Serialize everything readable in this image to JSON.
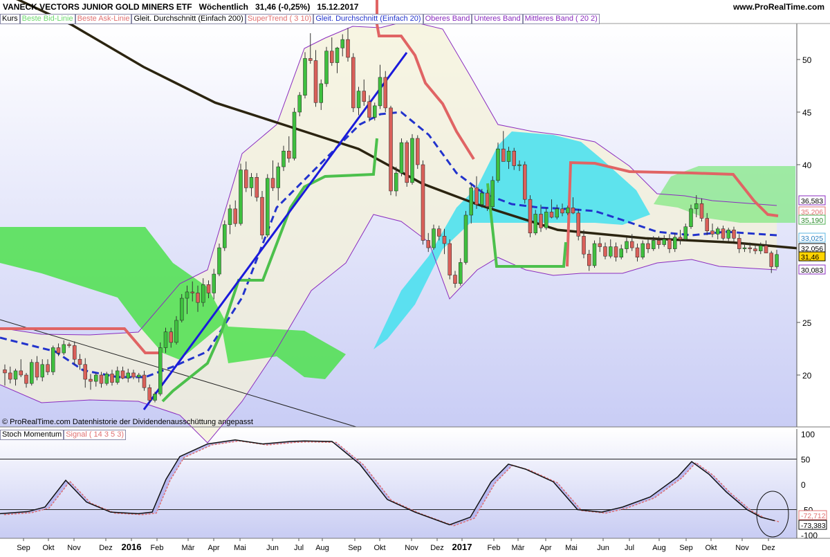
{
  "header": {
    "instrument": "VANECK VECTORS JUNIOR GOLD MINERS ETF",
    "period": "Wöchentlich",
    "last": "31,46 (-0,25%)",
    "date": "15.12.2017",
    "site": "www.ProRealTime.com"
  },
  "legend": [
    {
      "label": "Kurs",
      "color": "#000000"
    },
    {
      "label": "Beste Bid-Linie",
      "color": "#6dd86d"
    },
    {
      "label": "Beste Ask-Linie",
      "color": "#e07070"
    },
    {
      "label": "Gleit. Durchschnitt (Einfach 200)",
      "color": "#000000"
    },
    {
      "label": "SuperTrend ( 3 10)",
      "color": "#e07070"
    },
    {
      "label": "Gleit. Durchschnitt (Einfach 20)",
      "color": "#2233cc"
    },
    {
      "label": "Oberes Band",
      "color": "#8a2bbf"
    },
    {
      "label": "Unteres Band",
      "color": "#8a2bbf"
    },
    {
      "label": "Mittleres Band ( 20 2)",
      "color": "#8a2bbf"
    }
  ],
  "footnote": "© ProRealTime.com  Datenhistorie der Dividendenausschüttung angepasst",
  "lower_legend": [
    {
      "label": "Stoch Momentum",
      "color": "#000000"
    },
    {
      "label": "Signal ( 14 3 5 3)",
      "color": "#e07070"
    }
  ],
  "x_labels": [
    "Sep",
    "Okt",
    "Nov",
    "Dez",
    "2016",
    "Feb",
    "Mär",
    "Apr",
    "Mai",
    "Jun",
    "Jul",
    "Aug",
    "Sep",
    "Okt",
    "Nov",
    "Dez",
    "2017",
    "Feb",
    "Mär",
    "Apr",
    "Mai",
    "Jun",
    "Jul",
    "Aug",
    "Sep",
    "Okt",
    "Nov",
    "Dez"
  ],
  "x_bold": [
    "2016",
    "2017"
  ],
  "price_axis": {
    "ticks": [
      "50",
      "45",
      "40",
      "25",
      "20"
    ]
  },
  "price_badges": [
    {
      "text": "36,583",
      "border": "#8a2bbf",
      "bg": "#ffffff",
      "color": "#000000"
    },
    {
      "text": "35,206",
      "border": "#e07070",
      "bg": "#ffffff",
      "color": "#e07070"
    },
    {
      "text": "35,190",
      "border": "#4caf50",
      "bg": "#ffffff",
      "color": "#2e8b2e"
    },
    {
      "text": "33,025",
      "border": "#5bb5e0",
      "bg": "#ffffff",
      "color": "#2a7fc0"
    },
    {
      "text": "32,056",
      "border": "#000000",
      "bg": "#ffffff",
      "color": "#000000"
    },
    {
      "text": "31,46",
      "border": "#000000",
      "bg": "#ffd400",
      "color": "#000000"
    },
    {
      "text": "30,083",
      "border": "#8a2bbf",
      "bg": "#ffffff",
      "color": "#000000"
    }
  ],
  "momentum_axis": {
    "ticks": [
      "100",
      "50",
      "0",
      "-50",
      "-100"
    ]
  },
  "momentum_badges": [
    {
      "text": "-72,712",
      "border": "#e07070",
      "color": "#e07070"
    },
    {
      "text": "-73,383",
      "border": "#000000",
      "color": "#000000"
    }
  ],
  "chart_data": {
    "type": "candlestick",
    "ylim": [
      16,
      54
    ],
    "candles": [
      [
        20.5,
        21.0,
        19.0,
        20.2
      ],
      [
        20.2,
        20.8,
        19.2,
        19.6
      ],
      [
        19.6,
        20.6,
        19.0,
        20.4
      ],
      [
        20.4,
        21.5,
        19.8,
        20.0
      ],
      [
        20.0,
        20.2,
        18.8,
        19.2
      ],
      [
        19.2,
        21.5,
        19.0,
        21.2
      ],
      [
        21.2,
        21.8,
        19.5,
        19.8
      ],
      [
        19.8,
        21.5,
        19.4,
        21.0
      ],
      [
        21.0,
        21.5,
        20.0,
        20.3
      ],
      [
        20.3,
        22.8,
        20.0,
        22.6
      ],
      [
        22.6,
        23.0,
        21.8,
        22.1
      ],
      [
        22.1,
        23.3,
        21.9,
        22.9
      ],
      [
        22.9,
        23.1,
        22.6,
        22.8
      ],
      [
        22.8,
        23.2,
        21.0,
        21.5
      ],
      [
        21.5,
        22.0,
        20.5,
        21.0
      ],
      [
        21.0,
        21.6,
        18.8,
        19.6
      ],
      [
        19.6,
        20.1,
        18.6,
        19.4
      ],
      [
        19.4,
        20.2,
        18.9,
        20.0
      ],
      [
        20.0,
        20.3,
        18.8,
        19.2
      ],
      [
        19.2,
        20.3,
        19.0,
        20.1
      ],
      [
        20.1,
        20.5,
        19.0,
        19.3
      ],
      [
        19.3,
        20.8,
        19.1,
        20.4
      ],
      [
        20.4,
        20.8,
        19.6,
        19.7
      ],
      [
        19.7,
        20.6,
        19.3,
        20.2
      ],
      [
        20.2,
        20.5,
        19.6,
        19.8
      ],
      [
        19.8,
        20.2,
        19.3,
        20.0
      ],
      [
        20.0,
        20.4,
        18.5,
        18.8
      ],
      [
        18.8,
        19.1,
        17.3,
        17.6
      ],
      [
        17.6,
        18.4,
        17.4,
        18.2
      ],
      [
        18.2,
        23.1,
        18.0,
        22.6
      ],
      [
        22.6,
        24.5,
        22.1,
        24.1
      ],
      [
        24.1,
        24.5,
        22.6,
        23.1
      ],
      [
        23.1,
        25.6,
        22.9,
        25.2
      ],
      [
        25.2,
        27.7,
        25.0,
        27.3
      ],
      [
        27.3,
        28.5,
        25.8,
        27.9
      ],
      [
        27.9,
        28.9,
        27.0,
        27.8
      ],
      [
        27.8,
        28.5,
        26.0,
        26.9
      ],
      [
        26.9,
        29.2,
        26.5,
        28.6
      ],
      [
        28.6,
        29.0,
        27.3,
        27.8
      ],
      [
        27.8,
        30.1,
        27.2,
        29.6
      ],
      [
        29.6,
        32.5,
        29.4,
        32.1
      ],
      [
        32.1,
        34.7,
        31.8,
        34.3
      ],
      [
        34.3,
        36.2,
        33.4,
        35.8
      ],
      [
        35.8,
        36.6,
        34.1,
        34.4
      ],
      [
        34.4,
        40.1,
        34.2,
        39.5
      ],
      [
        39.5,
        40.3,
        37.4,
        37.8
      ],
      [
        37.8,
        39.2,
        37.0,
        38.8
      ],
      [
        38.8,
        39.2,
        36.5,
        36.9
      ],
      [
        36.9,
        37.5,
        32.9,
        33.3
      ],
      [
        33.3,
        39.1,
        33.1,
        38.7
      ],
      [
        38.7,
        40.4,
        37.5,
        37.8
      ],
      [
        37.8,
        40.2,
        36.6,
        39.8
      ],
      [
        39.8,
        41.8,
        39.4,
        41.3
      ],
      [
        41.3,
        42.7,
        40.2,
        40.6
      ],
      [
        40.6,
        45.4,
        40.4,
        45.0
      ],
      [
        45.0,
        46.9,
        44.6,
        46.6
      ],
      [
        46.6,
        50.7,
        46.3,
        50.1
      ],
      [
        50.1,
        52.5,
        49.6,
        49.9
      ],
      [
        49.9,
        50.9,
        45.5,
        45.9
      ],
      [
        45.9,
        48.1,
        45.2,
        47.7
      ],
      [
        47.7,
        51.2,
        47.4,
        50.8
      ],
      [
        50.8,
        52.1,
        49.4,
        49.7
      ],
      [
        49.7,
        51.2,
        48.7,
        51.1
      ],
      [
        51.1,
        52.4,
        50.3,
        51.9
      ],
      [
        51.9,
        53.0,
        49.8,
        50.2
      ],
      [
        50.2,
        50.6,
        45.0,
        45.4
      ],
      [
        45.4,
        47.4,
        44.7,
        47.0
      ],
      [
        47.0,
        48.1,
        45.6,
        46.0
      ],
      [
        46.0,
        46.6,
        44.1,
        44.5
      ],
      [
        44.5,
        45.9,
        44.2,
        45.6
      ],
      [
        45.6,
        49.5,
        45.3,
        48.3
      ],
      [
        48.3,
        48.9,
        45.0,
        45.4
      ],
      [
        45.4,
        45.6,
        37.1,
        37.5
      ],
      [
        37.5,
        39.8,
        37.0,
        39.2
      ],
      [
        39.2,
        42.5,
        38.9,
        42.1
      ],
      [
        42.1,
        42.3,
        37.9,
        38.3
      ],
      [
        38.3,
        42.9,
        38.1,
        42.5
      ],
      [
        42.5,
        42.8,
        39.6,
        40.0
      ],
      [
        40.0,
        40.4,
        32.4,
        32.8
      ],
      [
        32.8,
        33.5,
        31.7,
        32.1
      ],
      [
        32.1,
        34.3,
        31.9,
        33.9
      ],
      [
        33.9,
        34.2,
        32.8,
        33.2
      ],
      [
        33.2,
        33.9,
        31.5,
        32.5
      ],
      [
        32.5,
        32.9,
        29.1,
        29.5
      ],
      [
        29.5,
        29.9,
        28.3,
        28.7
      ],
      [
        28.7,
        31.1,
        28.5,
        30.7
      ],
      [
        30.7,
        35.6,
        30.5,
        35.2
      ],
      [
        35.2,
        38.2,
        34.4,
        37.8
      ],
      [
        37.8,
        38.9,
        35.8,
        36.2
      ],
      [
        36.2,
        37.7,
        35.9,
        37.3
      ],
      [
        37.3,
        37.6,
        35.6,
        36.0
      ],
      [
        36.0,
        38.9,
        35.8,
        38.5
      ],
      [
        38.5,
        42.1,
        38.3,
        41.5
      ],
      [
        41.5,
        43.2,
        40.9,
        40.3
      ],
      [
        40.3,
        41.7,
        39.6,
        41.3
      ],
      [
        41.3,
        41.6,
        39.5,
        39.9
      ],
      [
        39.9,
        40.4,
        39.4,
        40.0
      ],
      [
        40.0,
        40.3,
        36.3,
        36.7
      ],
      [
        36.7,
        37.1,
        33.1,
        33.5
      ],
      [
        33.5,
        35.7,
        33.3,
        35.3
      ],
      [
        35.3,
        36.2,
        33.6,
        34.0
      ],
      [
        34.0,
        35.9,
        33.8,
        35.5
      ],
      [
        35.5,
        36.7,
        34.9,
        35.0
      ],
      [
        35.0,
        36.2,
        34.8,
        35.8
      ],
      [
        35.8,
        36.3,
        35.1,
        35.4
      ],
      [
        35.4,
        36.1,
        35.2,
        35.9
      ],
      [
        35.9,
        36.9,
        35.3,
        35.4
      ],
      [
        35.4,
        35.8,
        32.8,
        33.2
      ],
      [
        33.2,
        33.8,
        31.1,
        31.5
      ],
      [
        31.5,
        31.9,
        29.9,
        30.4
      ],
      [
        30.4,
        32.8,
        30.2,
        32.5
      ],
      [
        32.5,
        33.1,
        31.7,
        32.2
      ],
      [
        32.2,
        32.6,
        31.0,
        31.3
      ],
      [
        31.3,
        32.9,
        31.1,
        32.2
      ],
      [
        32.2,
        32.6,
        30.8,
        31.2
      ],
      [
        31.2,
        32.4,
        31.0,
        32.0
      ],
      [
        32.0,
        33.1,
        31.6,
        32.7
      ],
      [
        32.7,
        33.4,
        31.8,
        32.1
      ],
      [
        32.1,
        32.5,
        30.8,
        31.2
      ],
      [
        31.2,
        32.8,
        31.0,
        32.5
      ],
      [
        32.5,
        32.9,
        31.6,
        32.0
      ],
      [
        32.0,
        33.2,
        31.8,
        32.8
      ],
      [
        32.8,
        33.2,
        32.0,
        32.4
      ],
      [
        32.4,
        33.3,
        32.2,
        32.9
      ],
      [
        32.9,
        33.4,
        31.6,
        32.0
      ],
      [
        32.0,
        33.5,
        31.7,
        33.1
      ],
      [
        33.1,
        33.8,
        32.4,
        32.9
      ],
      [
        32.9,
        34.4,
        32.7,
        34.1
      ],
      [
        34.1,
        36.2,
        33.9,
        35.8
      ],
      [
        35.8,
        37.1,
        35.0,
        36.3
      ],
      [
        36.3,
        36.8,
        34.6,
        34.9
      ],
      [
        34.9,
        35.4,
        33.3,
        33.7
      ],
      [
        33.7,
        34.4,
        33.1,
        33.4
      ],
      [
        33.4,
        34.1,
        32.9,
        33.9
      ],
      [
        33.9,
        34.2,
        32.8,
        33.0
      ],
      [
        33.0,
        34.0,
        32.7,
        33.8
      ],
      [
        33.8,
        34.1,
        32.7,
        33.0
      ],
      [
        33.0,
        33.4,
        31.6,
        32.0
      ],
      [
        32.0,
        32.5,
        31.7,
        32.1
      ],
      [
        32.1,
        32.6,
        31.6,
        32.0
      ],
      [
        32.0,
        32.4,
        31.5,
        31.8
      ],
      [
        31.8,
        32.6,
        31.5,
        32.3
      ],
      [
        32.3,
        32.8,
        31.7,
        31.6
      ],
      [
        31.6,
        31.8,
        29.7,
        30.3
      ],
      [
        30.3,
        31.9,
        30.1,
        31.46
      ]
    ],
    "sma200": [
      [
        0,
        56.5
      ],
      [
        0.09,
        53.3
      ],
      [
        0.18,
        49.3
      ],
      [
        0.27,
        45.9
      ],
      [
        0.36,
        43.7
      ],
      [
        0.45,
        41.5
      ],
      [
        0.53,
        38.2
      ],
      [
        0.6,
        36.2
      ],
      [
        0.7,
        33.8
      ],
      [
        0.81,
        33.0
      ],
      [
        0.92,
        32.6
      ],
      [
        1.0,
        32.06
      ]
    ],
    "supertrend_note": "piecewise",
    "momentum_ylim": [
      -100,
      100
    ]
  }
}
